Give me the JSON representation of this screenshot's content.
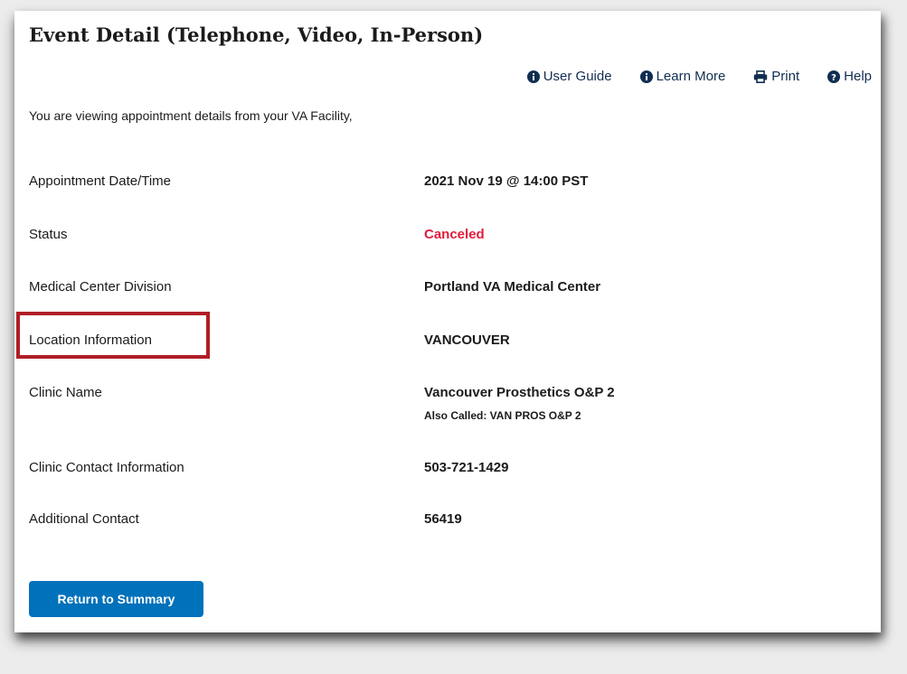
{
  "page": {
    "title": "Event Detail (Telephone, Video, In-Person)",
    "intro": "You are viewing appointment details from your VA Facility,"
  },
  "utility_links": [
    {
      "label": "User Guide",
      "icon": "info-circle-icon"
    },
    {
      "label": "Learn More",
      "icon": "info-circle-icon"
    },
    {
      "label": "Print",
      "icon": "print-icon"
    },
    {
      "label": "Help",
      "icon": "question-circle-icon"
    }
  ],
  "details": {
    "appointment_datetime": {
      "label": "Appointment Date/Time",
      "value": "2021 Nov 19 @ 14:00 PST"
    },
    "status": {
      "label": "Status",
      "value": "Canceled",
      "color": "#e31c3d"
    },
    "medical_center_division": {
      "label": "Medical Center Division",
      "value": "Portland VA Medical Center"
    },
    "location_information": {
      "label": "Location Information",
      "value": "VANCOUVER"
    },
    "clinic_name": {
      "label": "Clinic Name",
      "value": "Vancouver Prosthetics O&P 2",
      "also_called": "Also Called: VAN PROS O&P 2"
    },
    "clinic_contact": {
      "label": "Clinic Contact Information",
      "value": "503-721-1429"
    },
    "additional_contact": {
      "label": "Additional Contact",
      "value": "56419"
    }
  },
  "actions": {
    "return_label": "Return to Summary"
  },
  "colors": {
    "link": "#112e51",
    "button": "#0071bb",
    "highlight": "#b01e26",
    "canceled": "#e31c3d"
  }
}
